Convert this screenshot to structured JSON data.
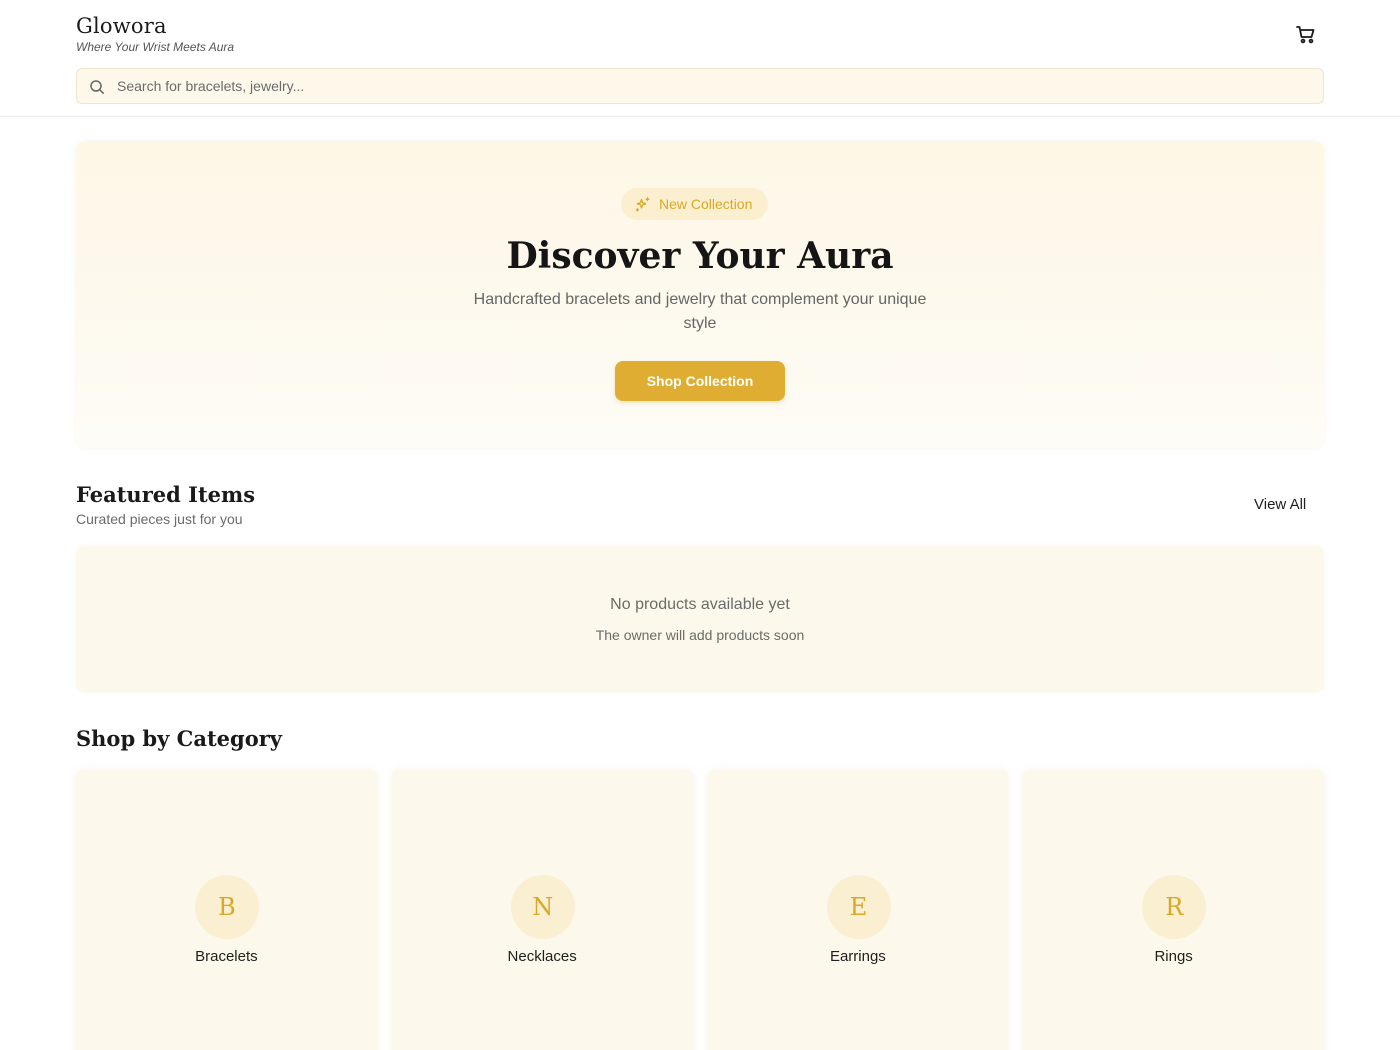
{
  "header": {
    "brand_name": "Glowora",
    "tagline": "Where Your Wrist Meets Aura",
    "cart_icon": "cart-icon"
  },
  "search": {
    "placeholder": "Search for bracelets, jewelry...",
    "value": "",
    "icon": "search-icon"
  },
  "hero": {
    "badge_label": "New Collection",
    "badge_icon": "sparkles-icon",
    "title": "Discover Your Aura",
    "subtitle": "Handcrafted bracelets and jewelry that complement your unique style",
    "cta_label": "Shop Collection"
  },
  "featured": {
    "title": "Featured Items",
    "subtitle": "Curated pieces just for you",
    "view_all_label": "View All",
    "empty_title": "No products available yet",
    "empty_subtitle": "The owner will add products soon"
  },
  "categories": {
    "title": "Shop by Category",
    "items": [
      {
        "initial": "B",
        "label": "Bracelets"
      },
      {
        "initial": "N",
        "label": "Necklaces"
      },
      {
        "initial": "E",
        "label": "Earrings"
      },
      {
        "initial": "R",
        "label": "Rings"
      }
    ]
  },
  "colors": {
    "accent": "#e0ad33",
    "accent_text": "#d9a826",
    "cream": "#fdf8ec"
  }
}
